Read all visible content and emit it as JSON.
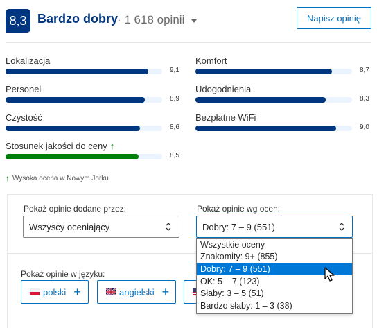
{
  "header": {
    "score": "8,3",
    "rating_word": "Bardzo dobry",
    "review_count": "· 1 618 opinii",
    "write_review_label": "Napisz opinię"
  },
  "categories": [
    {
      "label": "Lokalizacja",
      "value": "9,1",
      "score": 9.1
    },
    {
      "label": "Komfort",
      "value": "8,7",
      "score": 8.7
    },
    {
      "label": "Personel",
      "value": "8,9",
      "score": 8.9
    },
    {
      "label": "Udogodnienia",
      "value": "8,3",
      "score": 8.3
    },
    {
      "label": "Czystość",
      "value": "8,6",
      "score": 8.6
    },
    {
      "label": "Bezpłatne WiFi",
      "value": "9,0",
      "score": 9.0
    },
    {
      "label": "Stosunek jakości do ceny",
      "value": "8,5",
      "score": 8.5,
      "highlight": true
    }
  ],
  "high_rating_note": "Wysoka ocena w Nowym Jorku",
  "filters": {
    "reviewer_label": "Pokaż opinie dodane przez:",
    "reviewer_value": "Wszyscy oceniający",
    "score_label": "Pokaż opinie wg ocen:",
    "score_value": "Dobry: 7 – 9 (551)",
    "score_options": [
      "Wszystkie oceny",
      "Znakomity: 9+ (855)",
      "Dobry: 7 – 9 (551)",
      "OK: 5 – 7 (123)",
      "Słaby: 3 – 5 (51)",
      "Bardzo słaby: 1 – 3 (38)"
    ],
    "selected_option_index": 2,
    "language_label": "Pokaż opinie w języku:",
    "languages": [
      "polski",
      "angielski"
    ]
  },
  "colors": {
    "brand": "#003580",
    "accent": "#0071c2",
    "positive": "#008009",
    "selected": "#0078d7"
  }
}
